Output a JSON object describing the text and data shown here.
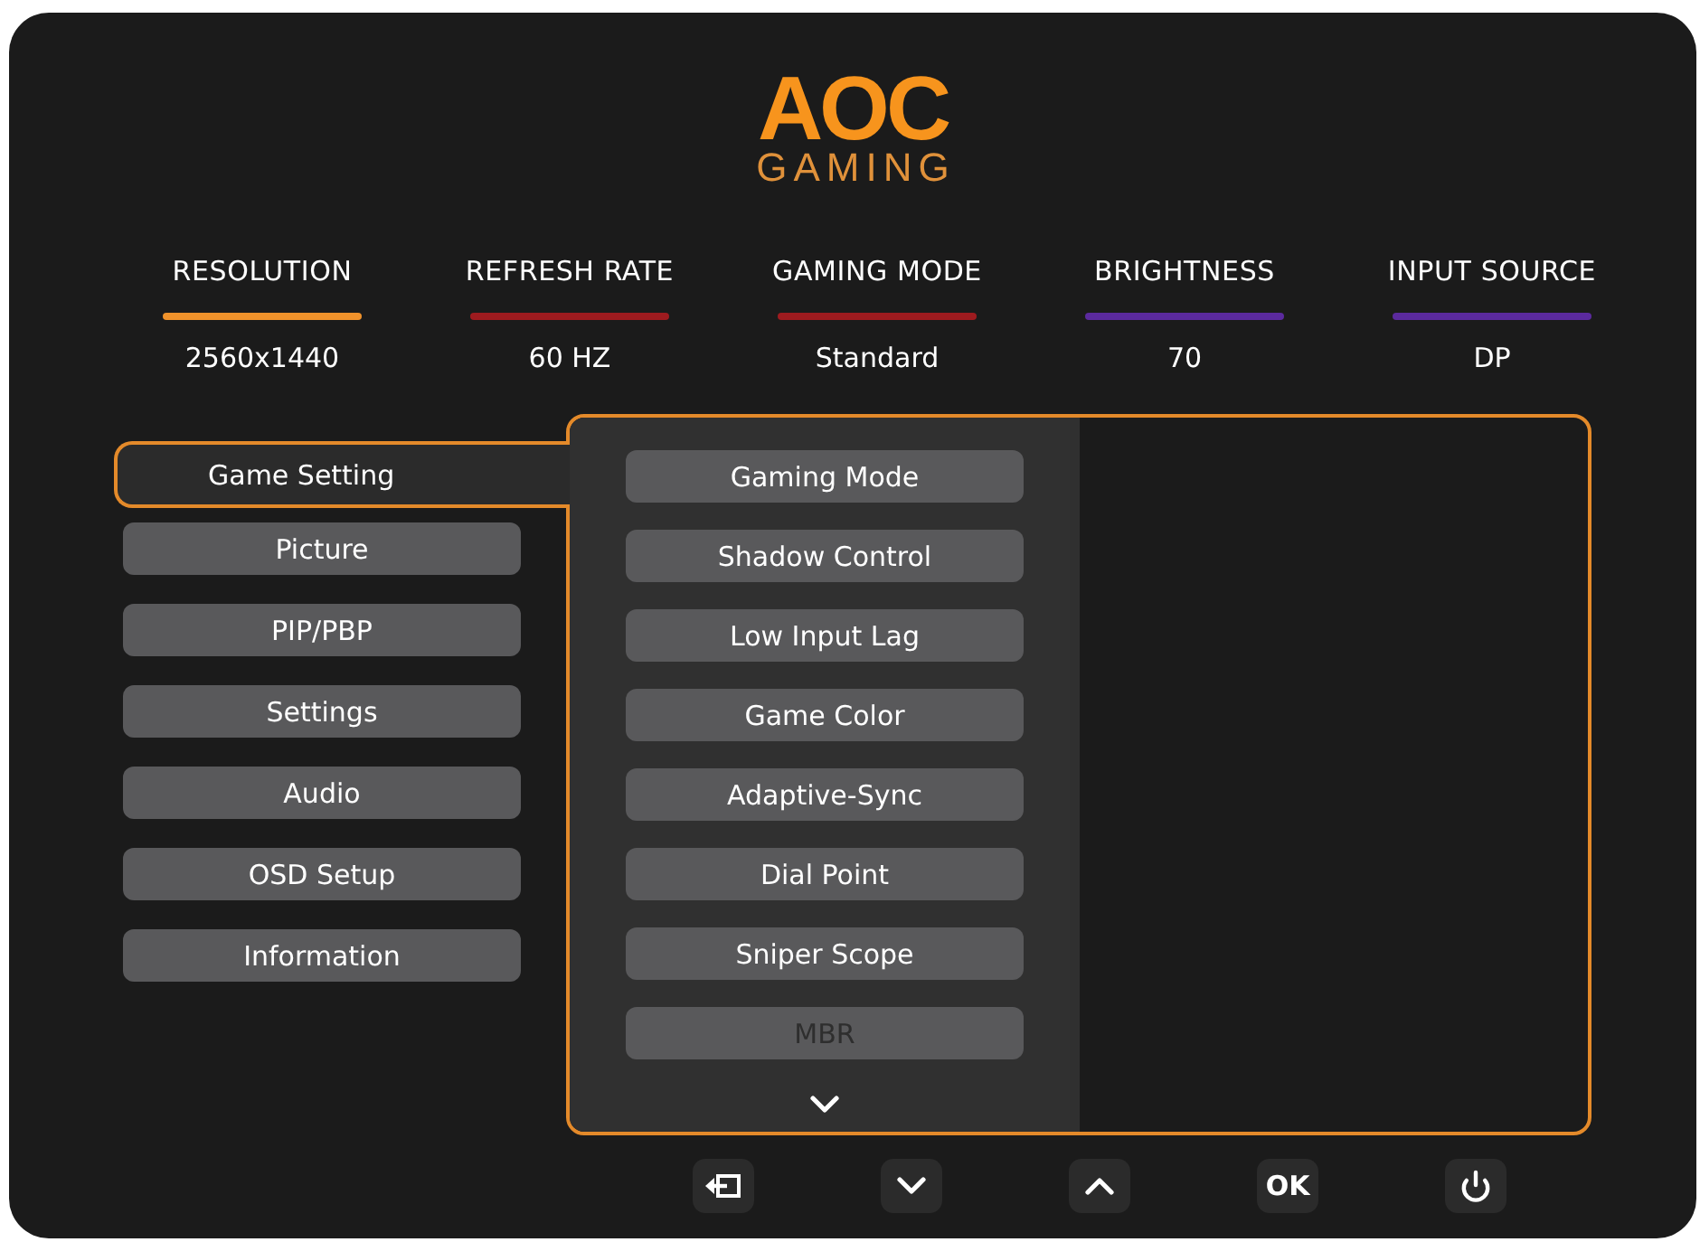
{
  "logo": {
    "brand": "AOC",
    "tagline": "GAMING"
  },
  "status": [
    {
      "label": "RESOLUTION",
      "value": "2560x1440",
      "color": "#f0922b"
    },
    {
      "label": "REFRESH RATE",
      "value": "60 HZ",
      "color": "#9e1b1f"
    },
    {
      "label": "GAMING MODE",
      "value": "Standard",
      "color": "#9e1b1f"
    },
    {
      "label": "BRIGHTNESS",
      "value": "70",
      "color": "#5b2a9e"
    },
    {
      "label": "INPUT SOURCE",
      "value": "DP",
      "color": "#5b2a9e"
    }
  ],
  "main_menu": [
    {
      "label": "Game Setting",
      "selected": true
    },
    {
      "label": "Picture",
      "selected": false
    },
    {
      "label": "PIP/PBP",
      "selected": false
    },
    {
      "label": "Settings",
      "selected": false
    },
    {
      "label": "Audio",
      "selected": false
    },
    {
      "label": "OSD Setup",
      "selected": false
    },
    {
      "label": "Information",
      "selected": false
    }
  ],
  "submenu": {
    "items": [
      {
        "label": "Gaming Mode",
        "disabled": false
      },
      {
        "label": "Shadow Control",
        "disabled": false
      },
      {
        "label": "Low Input Lag",
        "disabled": false
      },
      {
        "label": "Game Color",
        "disabled": false
      },
      {
        "label": "Adaptive-Sync",
        "disabled": false
      },
      {
        "label": "Dial Point",
        "disabled": false
      },
      {
        "label": "Sniper Scope",
        "disabled": false
      },
      {
        "label": "MBR",
        "disabled": true
      }
    ]
  },
  "buttons": [
    {
      "kind": "exit"
    },
    {
      "kind": "down"
    },
    {
      "kind": "up"
    },
    {
      "kind": "ok",
      "label": "OK"
    },
    {
      "kind": "power"
    }
  ]
}
